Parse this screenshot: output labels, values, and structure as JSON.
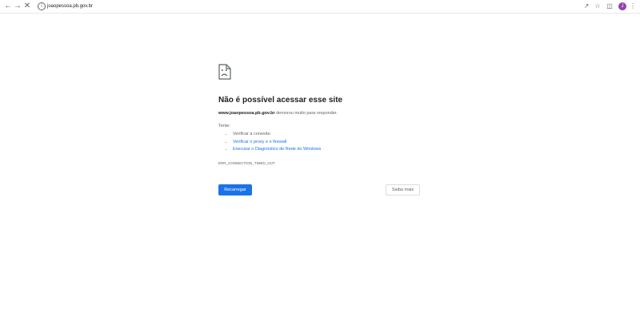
{
  "browser": {
    "url": "joaopessoa.pb.gov.br",
    "back_icon": "arrow-left-icon",
    "forward_icon": "arrow-right-icon",
    "stop_icon": "close-icon",
    "profile_initial": "J"
  },
  "error_page": {
    "title": "Não é possível acessar esse site",
    "host": "www.joaopessoa.pb.gov.br",
    "description_suffix": " demorou muito para responder.",
    "suggestions_label": "Tente:",
    "suggestions": [
      {
        "text": "Verificar a conexão",
        "link": false
      },
      {
        "text": "Verificar o proxy e o firewall",
        "link": true
      },
      {
        "text": "Executar o Diagnóstico de Rede do Windows",
        "link": true
      }
    ],
    "error_code": "ERR_CONNECTION_TIMED_OUT",
    "reload_label": "Recarregar",
    "details_label": "Saiba mais",
    "primary_color": "#1a73e8"
  }
}
